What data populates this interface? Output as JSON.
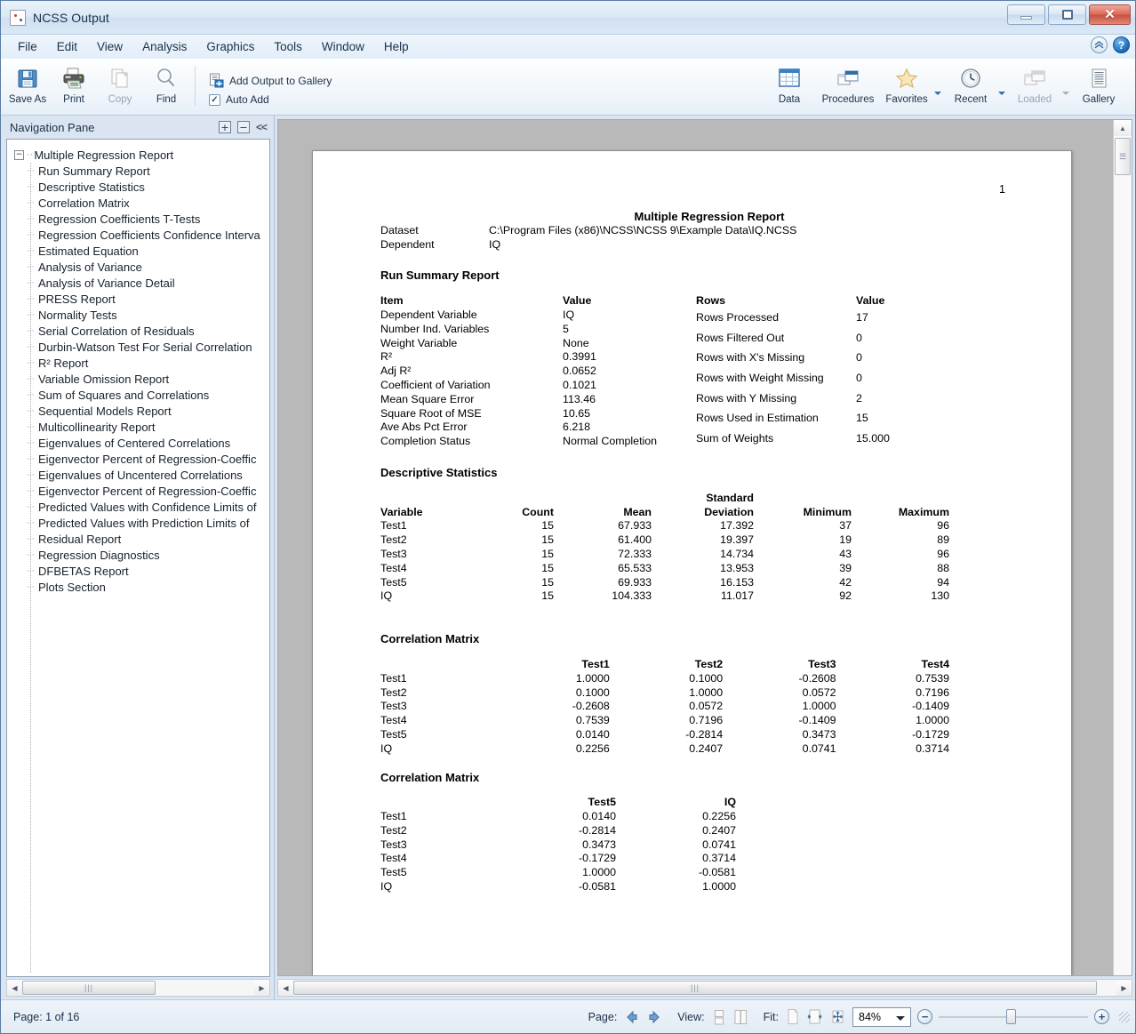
{
  "window": {
    "title": "NCSS Output",
    "controls": {
      "minimize": "Minimize",
      "maximize": "Maximize",
      "close": "Close",
      "close_glyph": "✕"
    }
  },
  "menubar": {
    "items": [
      "File",
      "Edit",
      "View",
      "Analysis",
      "Graphics",
      "Tools",
      "Window",
      "Help"
    ],
    "help_glyph": "?",
    "collapse_glyph": "⌃"
  },
  "toolbar": {
    "buttons": [
      {
        "label": "Save As",
        "icon": "save-icon",
        "disabled": false
      },
      {
        "label": "Print",
        "icon": "print-icon",
        "disabled": false
      },
      {
        "label": "Copy",
        "icon": "copy-icon",
        "disabled": true
      },
      {
        "label": "Find",
        "icon": "find-icon",
        "disabled": false
      }
    ],
    "gallery_action": "Add Output to Gallery",
    "auto_add": "Auto Add",
    "auto_add_checked": true,
    "check_glyph": "✓",
    "right_buttons": [
      {
        "label": "Data",
        "icon": "grid-icon",
        "caret": false,
        "disabled": false
      },
      {
        "label": "Procedures",
        "icon": "windows-icon",
        "caret": false,
        "disabled": false
      },
      {
        "label": "Favorites",
        "icon": "star-icon",
        "caret": true,
        "disabled": false
      },
      {
        "label": "Recent",
        "icon": "clock-icon",
        "caret": true,
        "disabled": false
      },
      {
        "label": "Loaded",
        "icon": "windows-dim-icon",
        "caret": true,
        "disabled": true
      },
      {
        "label": "Gallery",
        "icon": "document-lines-icon",
        "caret": false,
        "disabled": false
      }
    ]
  },
  "navpane": {
    "title": "Navigation Pane",
    "expand_glyph": "+",
    "collapse_glyph": "−",
    "hide_glyph": "<<",
    "root": "Multiple Regression Report",
    "root_toggle": "−",
    "items": [
      "Run Summary Report",
      "Descriptive Statistics",
      "Correlation Matrix",
      "Regression Coefficients T-Tests",
      "Regression Coefficients Confidence Interva",
      "Estimated Equation",
      "Analysis of Variance",
      "Analysis of Variance Detail",
      "PRESS Report",
      "Normality Tests",
      "Serial Correlation of Residuals",
      "Durbin-Watson Test For Serial Correlation",
      "R² Report",
      "Variable Omission Report",
      "Sum of Squares and Correlations",
      "Sequential Models Report",
      "Multicollinearity Report",
      "Eigenvalues of Centered Correlations",
      "Eigenvector Percent of Regression-Coeffic",
      "Eigenvalues of Uncentered Correlations",
      "Eigenvector Percent of Regression-Coeffic",
      "Predicted Values with Confidence Limits of",
      "Predicted Values with Prediction Limits of ",
      "Residual Report",
      "Regression Diagnostics",
      "DFBETAS Report",
      "Plots Section"
    ]
  },
  "document": {
    "page_number": "1",
    "report_title": "Multiple Regression Report",
    "header": [
      {
        "key": "Dataset",
        "value": "C:\\Program Files (x86)\\NCSS\\NCSS 9\\Example Data\\IQ.NCSS"
      },
      {
        "key": "Dependent",
        "value": "IQ"
      }
    ],
    "run_summary": {
      "heading": "Run Summary Report",
      "left_headers": [
        "Item",
        "Value"
      ],
      "left_rows": [
        [
          "Dependent Variable",
          "IQ"
        ],
        [
          "Number Ind. Variables",
          "5"
        ],
        [
          "Weight Variable",
          "None"
        ],
        [
          "R²",
          "0.3991"
        ],
        [
          "Adj R²",
          "0.0652"
        ],
        [
          "Coefficient of Variation",
          "0.1021"
        ],
        [
          "Mean Square Error",
          "113.46"
        ],
        [
          "Square Root of MSE",
          "10.65"
        ],
        [
          "Ave Abs Pct Error",
          "6.218"
        ],
        [
          "Completion Status",
          "Normal Completion"
        ]
      ],
      "right_headers": [
        "Rows",
        "Value"
      ],
      "right_rows": [
        [
          "Rows Processed",
          "17"
        ],
        [
          "Rows Filtered Out",
          "0"
        ],
        [
          "Rows with X's Missing",
          "0"
        ],
        [
          "Rows with Weight Missing",
          "0"
        ],
        [
          "Rows with Y Missing",
          "2"
        ],
        [
          "Rows Used in Estimation",
          "15"
        ],
        [
          "Sum of Weights",
          "15.000"
        ]
      ]
    },
    "descriptive": {
      "heading": "Descriptive Statistics",
      "headers": [
        "Variable",
        "Count",
        "Mean",
        "Standard Deviation",
        "Minimum",
        "Maximum"
      ],
      "header_top_line": [
        "",
        "",
        "",
        "Standard",
        "",
        ""
      ],
      "header_bottom_line": [
        "Variable",
        "Count",
        "Mean",
        "Deviation",
        "Minimum",
        "Maximum"
      ],
      "rows": [
        [
          "Test1",
          "15",
          "67.933",
          "17.392",
          "37",
          "96"
        ],
        [
          "Test2",
          "15",
          "61.400",
          "19.397",
          "19",
          "89"
        ],
        [
          "Test3",
          "15",
          "72.333",
          "14.734",
          "43",
          "96"
        ],
        [
          "Test4",
          "15",
          "65.533",
          "13.953",
          "39",
          "88"
        ],
        [
          "Test5",
          "15",
          "69.933",
          "16.153",
          "42",
          "94"
        ],
        [
          "IQ",
          "15",
          "104.333",
          "11.017",
          "92",
          "130"
        ]
      ]
    },
    "correlation_1": {
      "heading": "Correlation Matrix",
      "headers": [
        "",
        "Test1",
        "Test2",
        "Test3",
        "Test4"
      ],
      "rows": [
        [
          "Test1",
          "1.0000",
          "0.1000",
          "-0.2608",
          "0.7539"
        ],
        [
          "Test2",
          "0.1000",
          "1.0000",
          "0.0572",
          "0.7196"
        ],
        [
          "Test3",
          "-0.2608",
          "0.0572",
          "1.0000",
          "-0.1409"
        ],
        [
          "Test4",
          "0.7539",
          "0.7196",
          "-0.1409",
          "1.0000"
        ],
        [
          "Test5",
          "0.0140",
          "-0.2814",
          "0.3473",
          "-0.1729"
        ],
        [
          "IQ",
          "0.2256",
          "0.2407",
          "0.0741",
          "0.3714"
        ]
      ]
    },
    "correlation_2": {
      "heading": "Correlation Matrix",
      "headers": [
        "",
        "Test5",
        "IQ"
      ],
      "rows": [
        [
          "Test1",
          "0.0140",
          "0.2256"
        ],
        [
          "Test2",
          "-0.2814",
          "0.2407"
        ],
        [
          "Test3",
          "0.3473",
          "0.0741"
        ],
        [
          "Test4",
          "-0.1729",
          "0.3714"
        ],
        [
          "Test5",
          "1.0000",
          "-0.0581"
        ],
        [
          "IQ",
          "-0.0581",
          "1.0000"
        ]
      ]
    }
  },
  "statusbar": {
    "page_status": "Page: 1 of 16",
    "page_label": "Page:",
    "view_label": "View:",
    "fit_label": "Fit:",
    "zoom_value": "84%",
    "zoom_out_glyph": "−",
    "zoom_in_glyph": "+"
  }
}
